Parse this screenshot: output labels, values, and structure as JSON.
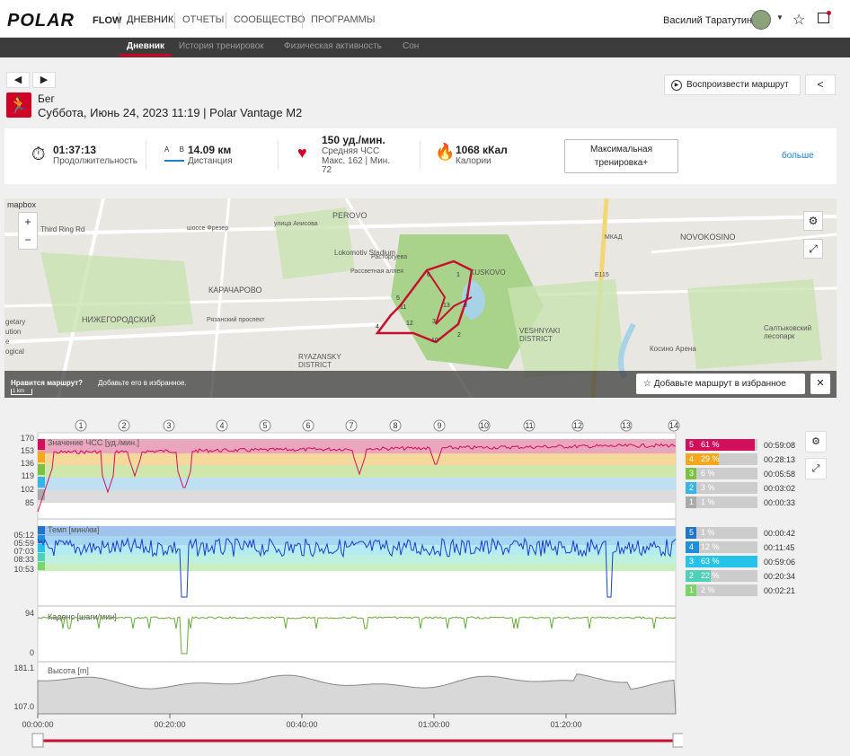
{
  "brand": {
    "logo": "POLAR",
    "product": "FLOW"
  },
  "nav": {
    "items": [
      "ДНЕВНИК",
      "ОТЧЕТЫ",
      "СООБЩЕСТВО",
      "ПРОГРАММЫ"
    ],
    "user": "Василий Таратутин"
  },
  "subnav": {
    "items": [
      "Дневник",
      "История тренировок",
      "Физическая активность",
      "Сон"
    ]
  },
  "session": {
    "sport": "Бег",
    "date": "Суббота, Июнь 24, 2023 11:19 | Polar Vantage M2"
  },
  "actions": {
    "play_route": "Воспроизвести маршрут"
  },
  "summary": {
    "duration_value": "01:37:13",
    "duration_label": "Продолжительность",
    "distance_value": "14.09 км",
    "distance_label": "Дистанция",
    "distance_icon_a": "A",
    "distance_icon_b": "B",
    "hr_value": "150 уд./мин.",
    "hr_label": "Средняя ЧСС",
    "hr_maxmin": "Макс. 162  |  Мин.",
    "hr_min": "72",
    "calories_value": "1068 кКал",
    "calories_label": "Калории",
    "benefit": "Максимальная тренировка+",
    "more": "больше"
  },
  "map": {
    "attribution": "mapbox",
    "labels": [
      "PEROVO",
      "NOVOKOSINO",
      "KUSKOVO",
      "КАРАЧАРОВО",
      "НИЖЕГОРОДСКИЙ",
      "VESHNYAKI DISTRICT",
      "RYAZANSKY DISTRICT",
      "Lokomotiv Stadium",
      "Рязанский проспект",
      "Салтыковский лесопарк",
      "Косино Арена",
      "Third Ring Rd",
      "шоссе Фрезер",
      "улица Анисова",
      "Расторгуева",
      "МКАД",
      "Рассветная аллея",
      "E115"
    ],
    "left_labels": [
      "getary",
      "ution",
      "e",
      "ogical"
    ],
    "markers": [
      "1",
      "2",
      "3",
      "4",
      "5",
      "6",
      "7",
      "8",
      "10",
      "11",
      "12",
      "13"
    ],
    "scale": "1 km",
    "banner_q": "Нравится маршрут?",
    "banner_text": "Добавьте его в избранное.",
    "fav_button": "Добавьте маршрут в избранное",
    "close": "✕",
    "zoom_in": "+",
    "zoom_out": "−"
  },
  "laps": [
    "1",
    "2",
    "3",
    "4",
    "5",
    "6",
    "7",
    "8",
    "9",
    "10",
    "11",
    "12",
    "13",
    "14"
  ],
  "charts": {
    "hr": {
      "label": "Значение ЧСС [уд./мин.]",
      "ticks": [
        "170",
        "153",
        "136",
        "119",
        "102",
        "85"
      ]
    },
    "pace": {
      "label": "Темп [мин/км]",
      "ticks": [
        "05:12",
        "05:59",
        "07:03",
        "08:33",
        "10:53"
      ]
    },
    "cadence": {
      "label": "Каденс [шаги/мин]",
      "ticks": [
        "94",
        "0"
      ]
    },
    "altitude": {
      "label": "Высота [m]",
      "ticks": [
        "181.1",
        "107.0"
      ]
    },
    "xaxis": [
      "00:00:00",
      "00:20:00",
      "00:40:00",
      "01:00:00",
      "01:20:00"
    ]
  },
  "hr_zones": [
    {
      "zone": "5",
      "pct": "61 %",
      "time": "00:59:08",
      "color": "#d10f5a",
      "fill": 0.61
    },
    {
      "zone": "4",
      "pct": "29 %",
      "time": "00:28:13",
      "color": "#f5a81c",
      "fill": 0.29
    },
    {
      "zone": "3",
      "pct": "6 %",
      "time": "00:05:58",
      "color": "#7cc142",
      "fill": 0.06
    },
    {
      "zone": "2",
      "pct": "3 %",
      "time": "00:03:02",
      "color": "#39b4e6",
      "fill": 0.03
    },
    {
      "zone": "1",
      "pct": "1 %",
      "time": "00:00:33",
      "color": "#aaaaaa",
      "fill": 0.01
    }
  ],
  "pace_zones": [
    {
      "zone": "5",
      "pct": "1 %",
      "time": "00:00:42",
      "color": "#1f75c9",
      "fill": 0.01
    },
    {
      "zone": "4",
      "pct": "12 %",
      "time": "00:11:45",
      "color": "#1f8fd9",
      "fill": 0.12
    },
    {
      "zone": "3",
      "pct": "63 %",
      "time": "00:59:06",
      "color": "#25c3e8",
      "fill": 0.63
    },
    {
      "zone": "2",
      "pct": "22 %",
      "time": "00:20:34",
      "color": "#4fd1b8",
      "fill": 0.22
    },
    {
      "zone": "1",
      "pct": "2 %",
      "time": "00:02:21",
      "color": "#7cd36b",
      "fill": 0.02
    }
  ]
}
